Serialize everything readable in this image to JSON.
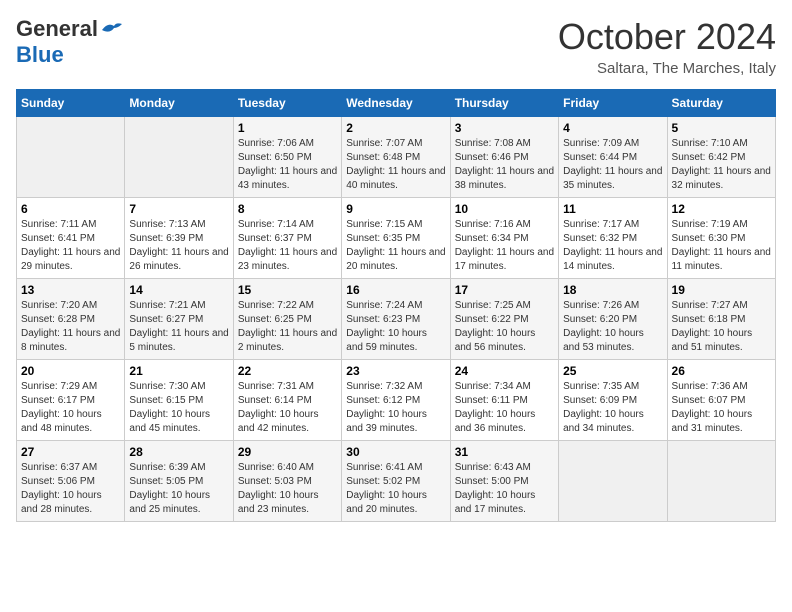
{
  "header": {
    "logo": {
      "general": "General",
      "blue": "Blue"
    },
    "title": "October 2024",
    "subtitle": "Saltara, The Marches, Italy"
  },
  "weekdays": [
    "Sunday",
    "Monday",
    "Tuesday",
    "Wednesday",
    "Thursday",
    "Friday",
    "Saturday"
  ],
  "weeks": [
    [
      {
        "day": "",
        "info": ""
      },
      {
        "day": "",
        "info": ""
      },
      {
        "day": "1",
        "sunrise": "7:06 AM",
        "sunset": "6:50 PM",
        "daylight": "11 hours and 43 minutes."
      },
      {
        "day": "2",
        "sunrise": "7:07 AM",
        "sunset": "6:48 PM",
        "daylight": "11 hours and 40 minutes."
      },
      {
        "day": "3",
        "sunrise": "7:08 AM",
        "sunset": "6:46 PM",
        "daylight": "11 hours and 38 minutes."
      },
      {
        "day": "4",
        "sunrise": "7:09 AM",
        "sunset": "6:44 PM",
        "daylight": "11 hours and 35 minutes."
      },
      {
        "day": "5",
        "sunrise": "7:10 AM",
        "sunset": "6:42 PM",
        "daylight": "11 hours and 32 minutes."
      }
    ],
    [
      {
        "day": "6",
        "sunrise": "7:11 AM",
        "sunset": "6:41 PM",
        "daylight": "11 hours and 29 minutes."
      },
      {
        "day": "7",
        "sunrise": "7:13 AM",
        "sunset": "6:39 PM",
        "daylight": "11 hours and 26 minutes."
      },
      {
        "day": "8",
        "sunrise": "7:14 AM",
        "sunset": "6:37 PM",
        "daylight": "11 hours and 23 minutes."
      },
      {
        "day": "9",
        "sunrise": "7:15 AM",
        "sunset": "6:35 PM",
        "daylight": "11 hours and 20 minutes."
      },
      {
        "day": "10",
        "sunrise": "7:16 AM",
        "sunset": "6:34 PM",
        "daylight": "11 hours and 17 minutes."
      },
      {
        "day": "11",
        "sunrise": "7:17 AM",
        "sunset": "6:32 PM",
        "daylight": "11 hours and 14 minutes."
      },
      {
        "day": "12",
        "sunrise": "7:19 AM",
        "sunset": "6:30 PM",
        "daylight": "11 hours and 11 minutes."
      }
    ],
    [
      {
        "day": "13",
        "sunrise": "7:20 AM",
        "sunset": "6:28 PM",
        "daylight": "11 hours and 8 minutes."
      },
      {
        "day": "14",
        "sunrise": "7:21 AM",
        "sunset": "6:27 PM",
        "daylight": "11 hours and 5 minutes."
      },
      {
        "day": "15",
        "sunrise": "7:22 AM",
        "sunset": "6:25 PM",
        "daylight": "11 hours and 2 minutes."
      },
      {
        "day": "16",
        "sunrise": "7:24 AM",
        "sunset": "6:23 PM",
        "daylight": "10 hours and 59 minutes."
      },
      {
        "day": "17",
        "sunrise": "7:25 AM",
        "sunset": "6:22 PM",
        "daylight": "10 hours and 56 minutes."
      },
      {
        "day": "18",
        "sunrise": "7:26 AM",
        "sunset": "6:20 PM",
        "daylight": "10 hours and 53 minutes."
      },
      {
        "day": "19",
        "sunrise": "7:27 AM",
        "sunset": "6:18 PM",
        "daylight": "10 hours and 51 minutes."
      }
    ],
    [
      {
        "day": "20",
        "sunrise": "7:29 AM",
        "sunset": "6:17 PM",
        "daylight": "10 hours and 48 minutes."
      },
      {
        "day": "21",
        "sunrise": "7:30 AM",
        "sunset": "6:15 PM",
        "daylight": "10 hours and 45 minutes."
      },
      {
        "day": "22",
        "sunrise": "7:31 AM",
        "sunset": "6:14 PM",
        "daylight": "10 hours and 42 minutes."
      },
      {
        "day": "23",
        "sunrise": "7:32 AM",
        "sunset": "6:12 PM",
        "daylight": "10 hours and 39 minutes."
      },
      {
        "day": "24",
        "sunrise": "7:34 AM",
        "sunset": "6:11 PM",
        "daylight": "10 hours and 36 minutes."
      },
      {
        "day": "25",
        "sunrise": "7:35 AM",
        "sunset": "6:09 PM",
        "daylight": "10 hours and 34 minutes."
      },
      {
        "day": "26",
        "sunrise": "7:36 AM",
        "sunset": "6:07 PM",
        "daylight": "10 hours and 31 minutes."
      }
    ],
    [
      {
        "day": "27",
        "sunrise": "6:37 AM",
        "sunset": "5:06 PM",
        "daylight": "10 hours and 28 minutes."
      },
      {
        "day": "28",
        "sunrise": "6:39 AM",
        "sunset": "5:05 PM",
        "daylight": "10 hours and 25 minutes."
      },
      {
        "day": "29",
        "sunrise": "6:40 AM",
        "sunset": "5:03 PM",
        "daylight": "10 hours and 23 minutes."
      },
      {
        "day": "30",
        "sunrise": "6:41 AM",
        "sunset": "5:02 PM",
        "daylight": "10 hours and 20 minutes."
      },
      {
        "day": "31",
        "sunrise": "6:43 AM",
        "sunset": "5:00 PM",
        "daylight": "10 hours and 17 minutes."
      },
      {
        "day": "",
        "info": ""
      },
      {
        "day": "",
        "info": ""
      }
    ]
  ]
}
